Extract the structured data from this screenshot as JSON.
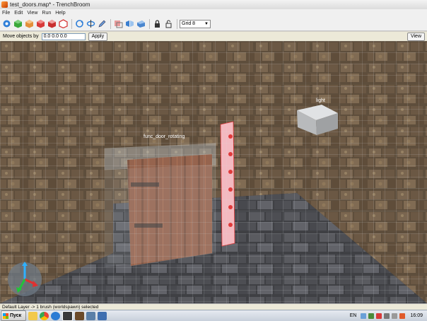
{
  "window": {
    "title": "test_doors.map* - TrenchBroom"
  },
  "menu": [
    "File",
    "Edit",
    "View",
    "Run",
    "Help"
  ],
  "toolbar": {
    "icons": [
      "entity-icon",
      "cube-green-icon",
      "cube-orange-icon",
      "cube-red-icon",
      "cube-red-icon",
      "cube-red-outline-icon",
      "rotate-icon",
      "rotate-axis-icon",
      "pencil-icon",
      "texture-lock-icon",
      "flip-icon",
      "camera-icon",
      "lock-icon",
      "lock-open-icon"
    ],
    "grid": {
      "selected": "Grid 8"
    }
  },
  "move": {
    "label": "Move objects by",
    "value": "0.0 0.0 0.0",
    "apply": "Apply",
    "view": "View"
  },
  "scene": {
    "door_label": "func_door_rotating",
    "light_label": "light"
  },
  "status": {
    "text": "Default Layer -> 1 brush (worldspawn) selected"
  },
  "taskbar": {
    "start": "Пуск",
    "language": "EN",
    "time": "16:09",
    "apps": [
      "explorer-icon",
      "chrome-icon",
      "ie-icon",
      "trenchbroom-icon",
      "game-icon",
      "editor-icon",
      "folder-icon"
    ]
  },
  "colors": {
    "accent": "#e03a3a",
    "grid": "#cfd6dd",
    "wall": "#6b5a46"
  }
}
